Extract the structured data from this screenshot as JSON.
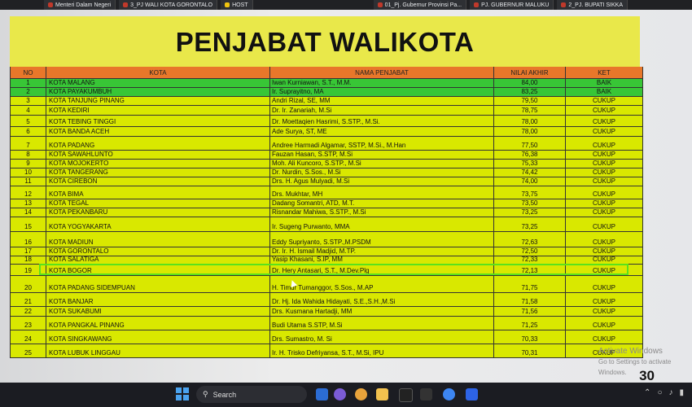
{
  "browser_tabs": [
    {
      "label": "Menteri Dalam Negeri"
    },
    {
      "label": "3_PJ WALI KOTA GORONTALO"
    },
    {
      "label": "HOST"
    },
    {
      "label": "01_Pj. Gubernur Provinsi Pa..."
    },
    {
      "label": "PJ. GUBERNUR MALUKU"
    },
    {
      "label": "2_PJ. BUPATI SIKKA"
    }
  ],
  "slide": {
    "title": "PENJABAT WALIKOTA",
    "page_number": "30",
    "headers": {
      "no": "NO",
      "kota": "KOTA",
      "nama": "NAMA PENJABAT",
      "nilai": "NILAI AKHIR",
      "ket": "KET"
    },
    "rows": [
      {
        "no": "1",
        "kota": "KOTA MALANG",
        "nama": "Iwan Kurniawan, S.T., M.M.",
        "nilai": "84,00",
        "ket": "BAIK",
        "status": "baik"
      },
      {
        "no": "2",
        "kota": "KOTA PAYAKUMBUH",
        "nama": "Ir. Suprayitno, MA",
        "nilai": "83,25",
        "ket": "BAIK",
        "status": "baik"
      },
      {
        "no": "3",
        "kota": "KOTA TANJUNG PINANG",
        "nama": "Andri Rizal, SE, MM",
        "nilai": "79,50",
        "ket": "CUKUP",
        "status": "cukup"
      },
      {
        "no": "4",
        "kota": "KOTA KEDIRI",
        "nama": "Dr. Ir. Zanariah, M.Si",
        "nilai": "78,75",
        "ket": "CUKUP",
        "status": "cukup"
      },
      {
        "no": "5",
        "kota": "KOTA TEBING TINGGI",
        "nama": "Dr. Moettaqien Hasrimi, S.STP., M.Si.",
        "nilai": "78,00",
        "ket": "CUKUP",
        "status": "cukup"
      },
      {
        "no": "6",
        "kota": "KOTA BANDA ACEH",
        "nama": "Ade Surya, ST, ME",
        "nilai": "78,00",
        "ket": "CUKUP",
        "status": "cukup"
      },
      {
        "no": "7",
        "kota": "KOTA PADANG",
        "nama": "Andree Harmadi Algamar, SSTP, M.Si., M.Han",
        "nilai": "77,50",
        "ket": "CUKUP",
        "status": "cukup"
      },
      {
        "no": "8",
        "kota": "KOTA SAWAHLUNTO",
        "nama": "Fauzan Hasan, S.STP, M.Si",
        "nilai": "76,38",
        "ket": "CUKUP",
        "status": "cukup"
      },
      {
        "no": "9",
        "kota": "KOTA MOJOKERTO",
        "nama": "Moh. Ali Kuncoro, S.STP., M.Si",
        "nilai": "75,33",
        "ket": "CUKUP",
        "status": "cukup"
      },
      {
        "no": "10",
        "kota": "KOTA TANGERANG",
        "nama": "Dr. Nurdin, S.Sos., M.Si",
        "nilai": "74,42",
        "ket": "CUKUP",
        "status": "cukup"
      },
      {
        "no": "11",
        "kota": "KOTA CIREBON",
        "nama": "Drs. H. Agus Mulyadi, M.Si",
        "nilai": "74,00",
        "ket": "CUKUP",
        "status": "cukup"
      },
      {
        "no": "12",
        "kota": "KOTA BIMA",
        "nama": "Drs. Mukhtar, MH",
        "nilai": "73,75",
        "ket": "CUKUP",
        "status": "cukup"
      },
      {
        "no": "13",
        "kota": "KOTA TEGAL",
        "nama": "Dadang Somantri, ATD, M.T.",
        "nilai": "73,50",
        "ket": "CUKUP",
        "status": "cukup"
      },
      {
        "no": "14",
        "kota": "KOTA PEKANBARU",
        "nama": "Risnandar Mahiwa, S.STP., M.Si",
        "nilai": "73,25",
        "ket": "CUKUP",
        "status": "cukup"
      },
      {
        "no": "15",
        "kota": "KOTA YOGYAKARTA",
        "nama": "Ir. Sugeng Purwanto, MMA",
        "nilai": "73,25",
        "ket": "CUKUP",
        "status": "cukup"
      },
      {
        "no": "16",
        "kota": "KOTA MADIUN",
        "nama": "Eddy Supriyanto, S.STP.,M.PSDM",
        "nilai": "72,63",
        "ket": "CUKUP",
        "status": "cukup"
      },
      {
        "no": "17",
        "kota": "KOTA GORONTALO",
        "nama": "Dr. Ir. H. Ismail Madjid, M.TP.",
        "nilai": "72,50",
        "ket": "CUKUP",
        "status": "cukup"
      },
      {
        "no": "18",
        "kota": "KOTA SALATIGA",
        "nama": "Yasip Khasani, S.IP, MM",
        "nilai": "72,33",
        "ket": "CUKUP",
        "status": "cukup"
      },
      {
        "no": "19",
        "kota": "KOTA BOGOR",
        "nama": "Dr. Hery Antasari, S.T., M.Dev.Plg",
        "nilai": "72,13",
        "ket": "CUKUP",
        "status": "cukup"
      },
      {
        "no": "20",
        "kota": "KOTA PADANG SIDEMPUAN",
        "nama": "H. Timur Tumanggor, S.Sos., M.AP",
        "nilai": "71,75",
        "ket": "CUKUP",
        "status": "cukup"
      },
      {
        "no": "21",
        "kota": "KOTA BANJAR",
        "nama": "Dr. Hj. Ida Wahida Hidayati, S.E.,S.H.,M.Si",
        "nilai": "71,58",
        "ket": "CUKUP",
        "status": "cukup"
      },
      {
        "no": "22",
        "kota": "KOTA SUKABUMI",
        "nama": "Drs. Kusmana Hartadji, MM",
        "nilai": "71,56",
        "ket": "CUKUP",
        "status": "cukup"
      },
      {
        "no": "23",
        "kota": "KOTA PANGKAL PINANG",
        "nama": "Budi Utama S.STP, M.Si",
        "nilai": "71,25",
        "ket": "CUKUP",
        "status": "cukup"
      },
      {
        "no": "24",
        "kota": "KOTA SINGKAWANG",
        "nama": "Drs. Sumastro, M. Si",
        "nilai": "70,33",
        "ket": "CUKUP",
        "status": "cukup"
      },
      {
        "no": "25",
        "kota": "KOTA LUBUK LINGGAU",
        "nama": "Ir. H. Trisko Defriyansa, S.T., M.Si, IPU",
        "nilai": "70,31",
        "ket": "CUKUP",
        "status": "cukup"
      }
    ]
  },
  "watermark": {
    "line1": "Activate Windows",
    "line2": "Go to Settings to activate Windows."
  },
  "taskbar": {
    "search_label": "Search"
  },
  "colors": {
    "green_row": "#38c636",
    "yellow_row": "#d9e800",
    "header": "#e8772a",
    "highlight": "#59e21c"
  }
}
